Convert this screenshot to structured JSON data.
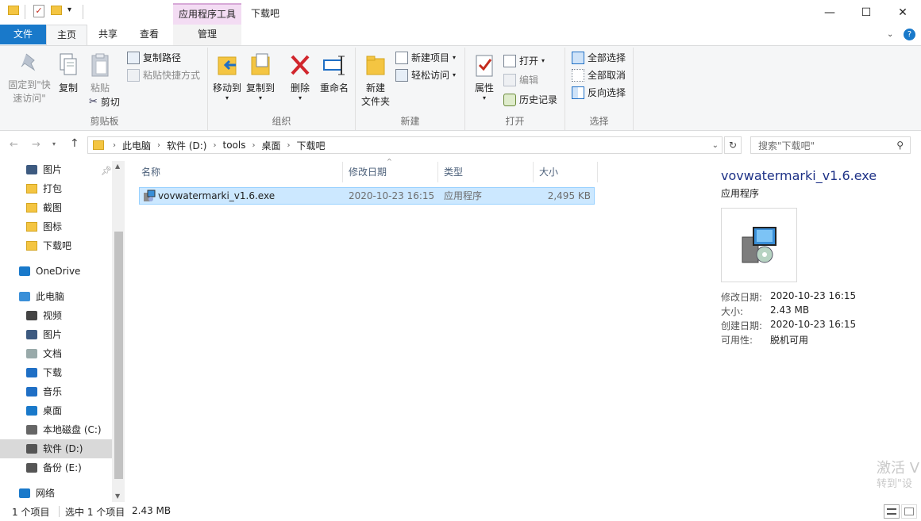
{
  "window": {
    "title": "下载吧",
    "contextual_tab_group": "应用程序工具",
    "minimize": "—",
    "maximize": "☐",
    "close": "✕"
  },
  "tabs": {
    "file": "文件",
    "home": "主页",
    "share": "共享",
    "view": "查看",
    "manage": "管理"
  },
  "ribbon": {
    "clipboard": {
      "label": "剪贴板",
      "pin_quick_access": "固定到\"快速访问\"",
      "copy": "复制",
      "paste": "粘贴",
      "copy_path": "复制路径",
      "paste_shortcut": "粘贴快捷方式",
      "cut": "剪切"
    },
    "organize": {
      "label": "组织",
      "move_to": "移动到",
      "copy_to": "复制到",
      "delete": "删除",
      "rename": "重命名"
    },
    "new": {
      "label": "新建",
      "new_folder_line1": "新建",
      "new_folder_line2": "文件夹",
      "new_item": "新建项目",
      "easy_access": "轻松访问"
    },
    "open": {
      "label": "打开",
      "properties": "属性",
      "open": "打开",
      "edit": "编辑",
      "history": "历史记录"
    },
    "select": {
      "label": "选择",
      "select_all": "全部选择",
      "select_none": "全部取消",
      "invert": "反向选择"
    }
  },
  "address": {
    "crumbs": [
      "此电脑",
      "软件 (D:)",
      "tools",
      "桌面",
      "下载吧"
    ],
    "search_placeholder": "搜索\"下载吧\""
  },
  "nav": {
    "items": [
      {
        "label": "图片",
        "icon": "pictures-icon"
      },
      {
        "label": "打包",
        "icon": "folder-icon"
      },
      {
        "label": "截图",
        "icon": "folder-icon"
      },
      {
        "label": "图标",
        "icon": "folder-icon"
      },
      {
        "label": "下载吧",
        "icon": "folder-icon"
      },
      {
        "label": "OneDrive",
        "icon": "onedrive-icon"
      },
      {
        "label": "此电脑",
        "icon": "this-pc-icon"
      },
      {
        "label": "视频",
        "icon": "videos-icon"
      },
      {
        "label": "图片",
        "icon": "pictures-icon"
      },
      {
        "label": "文档",
        "icon": "documents-icon"
      },
      {
        "label": "下载",
        "icon": "downloads-icon"
      },
      {
        "label": "音乐",
        "icon": "music-icon"
      },
      {
        "label": "桌面",
        "icon": "desktop-icon"
      },
      {
        "label": "本地磁盘 (C:)",
        "icon": "drive-c-icon"
      },
      {
        "label": "软件 (D:)",
        "icon": "drive-icon"
      },
      {
        "label": "备份 (E:)",
        "icon": "drive-icon"
      },
      {
        "label": "网络",
        "icon": "network-icon"
      }
    ]
  },
  "filelist": {
    "columns": {
      "name": "名称",
      "modified": "修改日期",
      "type": "类型",
      "size": "大小"
    },
    "rows": [
      {
        "name": "vovwatermarki_v1.6.exe",
        "modified": "2020-10-23 16:15",
        "type": "应用程序",
        "size": "2,495 KB"
      }
    ]
  },
  "preview": {
    "name": "vovwatermarki_v1.6.exe",
    "type": "应用程序",
    "modified_label": "修改日期:",
    "modified": "2020-10-23 16:15",
    "size_label": "大小:",
    "size": "2.43 MB",
    "created_label": "创建日期:",
    "created": "2020-10-23 16:15",
    "availability_label": "可用性:",
    "availability": "脱机可用"
  },
  "status": {
    "item_count": "1 个项目",
    "selected": "选中 1 个项目",
    "selected_size": "2.43 MB"
  },
  "watermark": {
    "line1": "激活 V",
    "line2": "转到\"设"
  }
}
